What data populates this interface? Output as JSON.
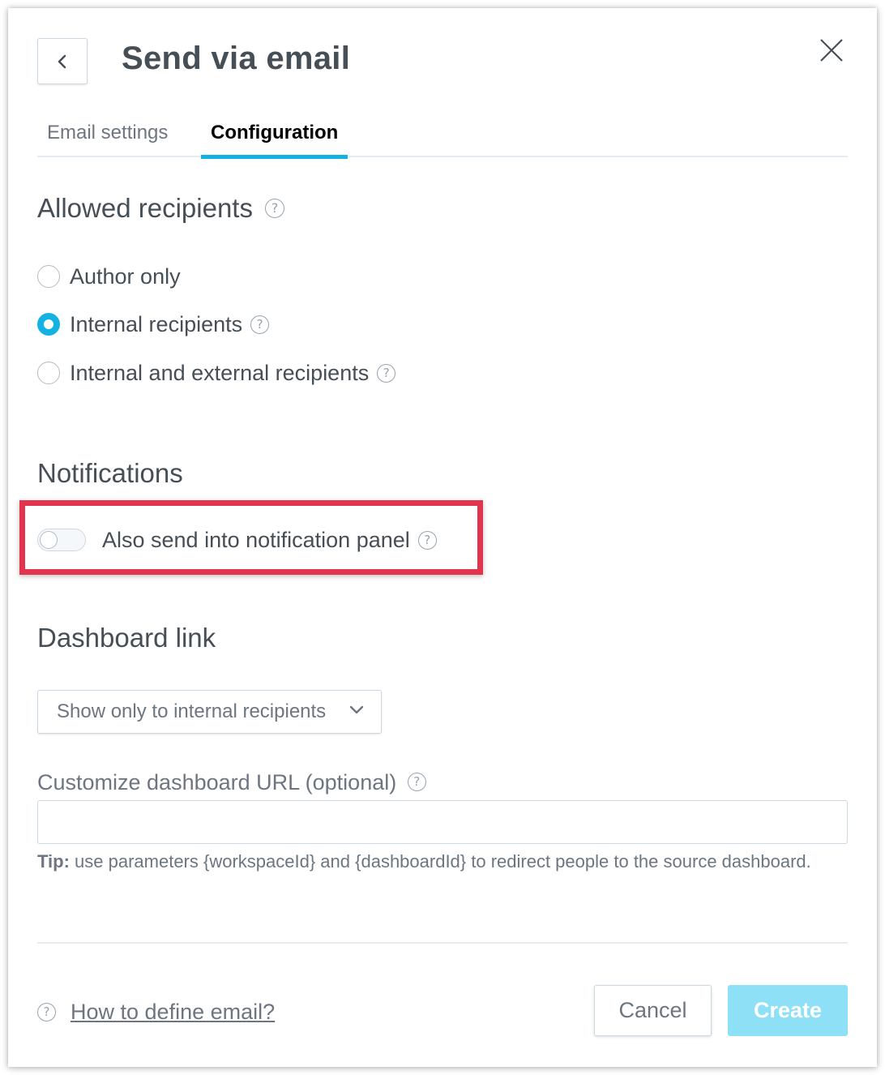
{
  "header": {
    "title": "Send via email",
    "back_icon": "chevron-left-icon",
    "close_icon": "close-icon"
  },
  "tabs": [
    {
      "label": "Email settings",
      "active": false
    },
    {
      "label": "Configuration",
      "active": true
    }
  ],
  "allowed_recipients": {
    "title": "Allowed recipients",
    "options": [
      {
        "label": "Author only",
        "checked": false,
        "help": false
      },
      {
        "label": "Internal recipients",
        "checked": true,
        "help": true
      },
      {
        "label": "Internal and external recipients",
        "checked": false,
        "help": true
      }
    ]
  },
  "notifications": {
    "title": "Notifications",
    "toggle_label": "Also send into notification panel",
    "toggle_on": false,
    "highlight_color": "#e2344d"
  },
  "dashboard_link": {
    "title": "Dashboard link",
    "select_value": "Show only to internal recipients",
    "url_label": "Customize dashboard URL (optional)",
    "url_value": "",
    "tip_bold": "Tip:",
    "tip_text": " use parameters {workspaceId} and {dashboardId} to redirect people to the source dashboard."
  },
  "footer": {
    "help_link": "How to define email?",
    "cancel_label": "Cancel",
    "create_label": "Create"
  },
  "colors": {
    "accent": "#14b2e2",
    "create_disabled": "#8ee0f6",
    "text": "#464e56",
    "muted": "#6d7680"
  }
}
